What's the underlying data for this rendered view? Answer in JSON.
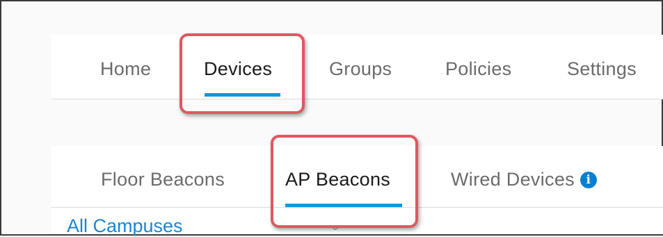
{
  "main_nav": {
    "tabs": [
      {
        "label": "Home",
        "active": false
      },
      {
        "label": "Devices",
        "active": true
      },
      {
        "label": "Groups",
        "active": false
      },
      {
        "label": "Policies",
        "active": false
      },
      {
        "label": "Settings",
        "active": false
      }
    ]
  },
  "sub_nav": {
    "tabs": [
      {
        "label": "Floor Beacons",
        "active": false
      },
      {
        "label": "AP Beacons",
        "active": true
      },
      {
        "label": "Wired Devices",
        "active": false,
        "icon": "info-icon",
        "icon_glyph": "i"
      }
    ]
  },
  "campus_selector": {
    "label": "All Campuses",
    "icon": "chevron-down-icon"
  },
  "colors": {
    "accent": "#0d9ad8",
    "link": "#1a86d0",
    "highlight": "#e05761",
    "info_icon": "#0a7fd1"
  }
}
